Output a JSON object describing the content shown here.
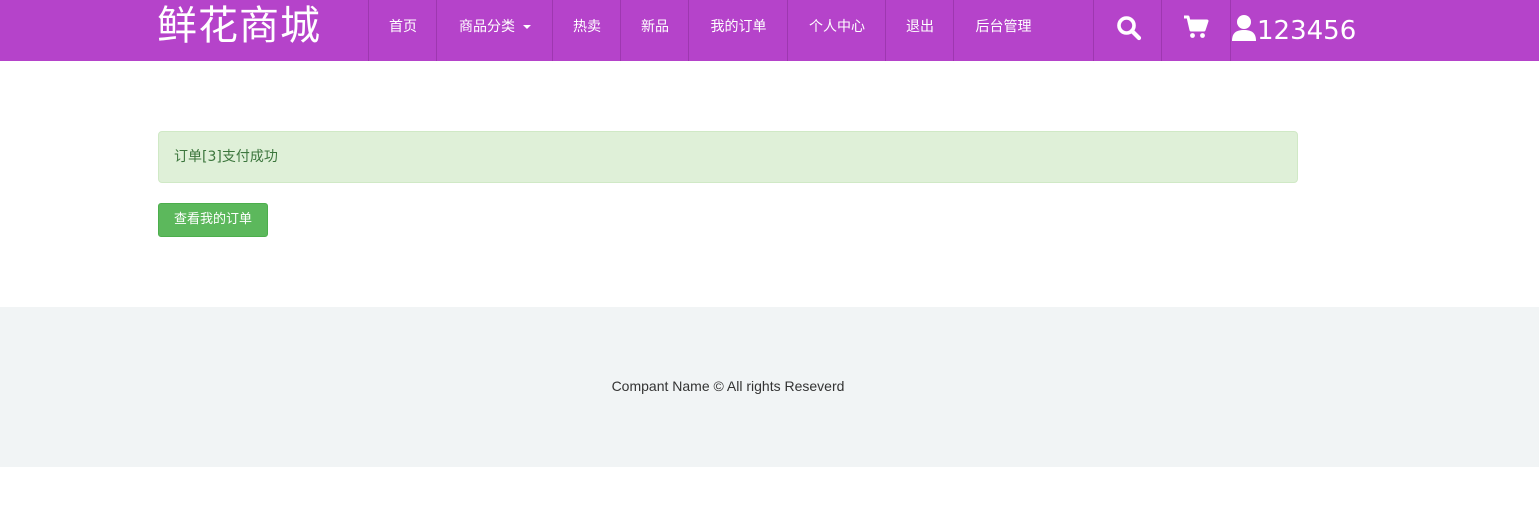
{
  "brand": "鲜花商城",
  "nav": {
    "items": [
      {
        "label": "首页"
      },
      {
        "label": "商品分类"
      },
      {
        "label": "热卖"
      },
      {
        "label": "新品"
      },
      {
        "label": "我的订单"
      },
      {
        "label": "个人中心"
      },
      {
        "label": "退出"
      },
      {
        "label": "后台管理"
      }
    ],
    "username": "123456",
    "icons": [
      "search-icon",
      "cart-icon",
      "user-icon",
      "caret-down-icon"
    ]
  },
  "alert": {
    "message": "订单[3]支付成功"
  },
  "action": {
    "view_orders_label": "查看我的订单"
  },
  "footer": {
    "text": "Compant Name © All rights Reseverd"
  },
  "colors": {
    "navbar": "#b543ca",
    "alert_bg": "#dff0d8",
    "alert_text": "#3c763d",
    "button": "#5cb85c",
    "footer_bg": "#f1f4f5"
  }
}
